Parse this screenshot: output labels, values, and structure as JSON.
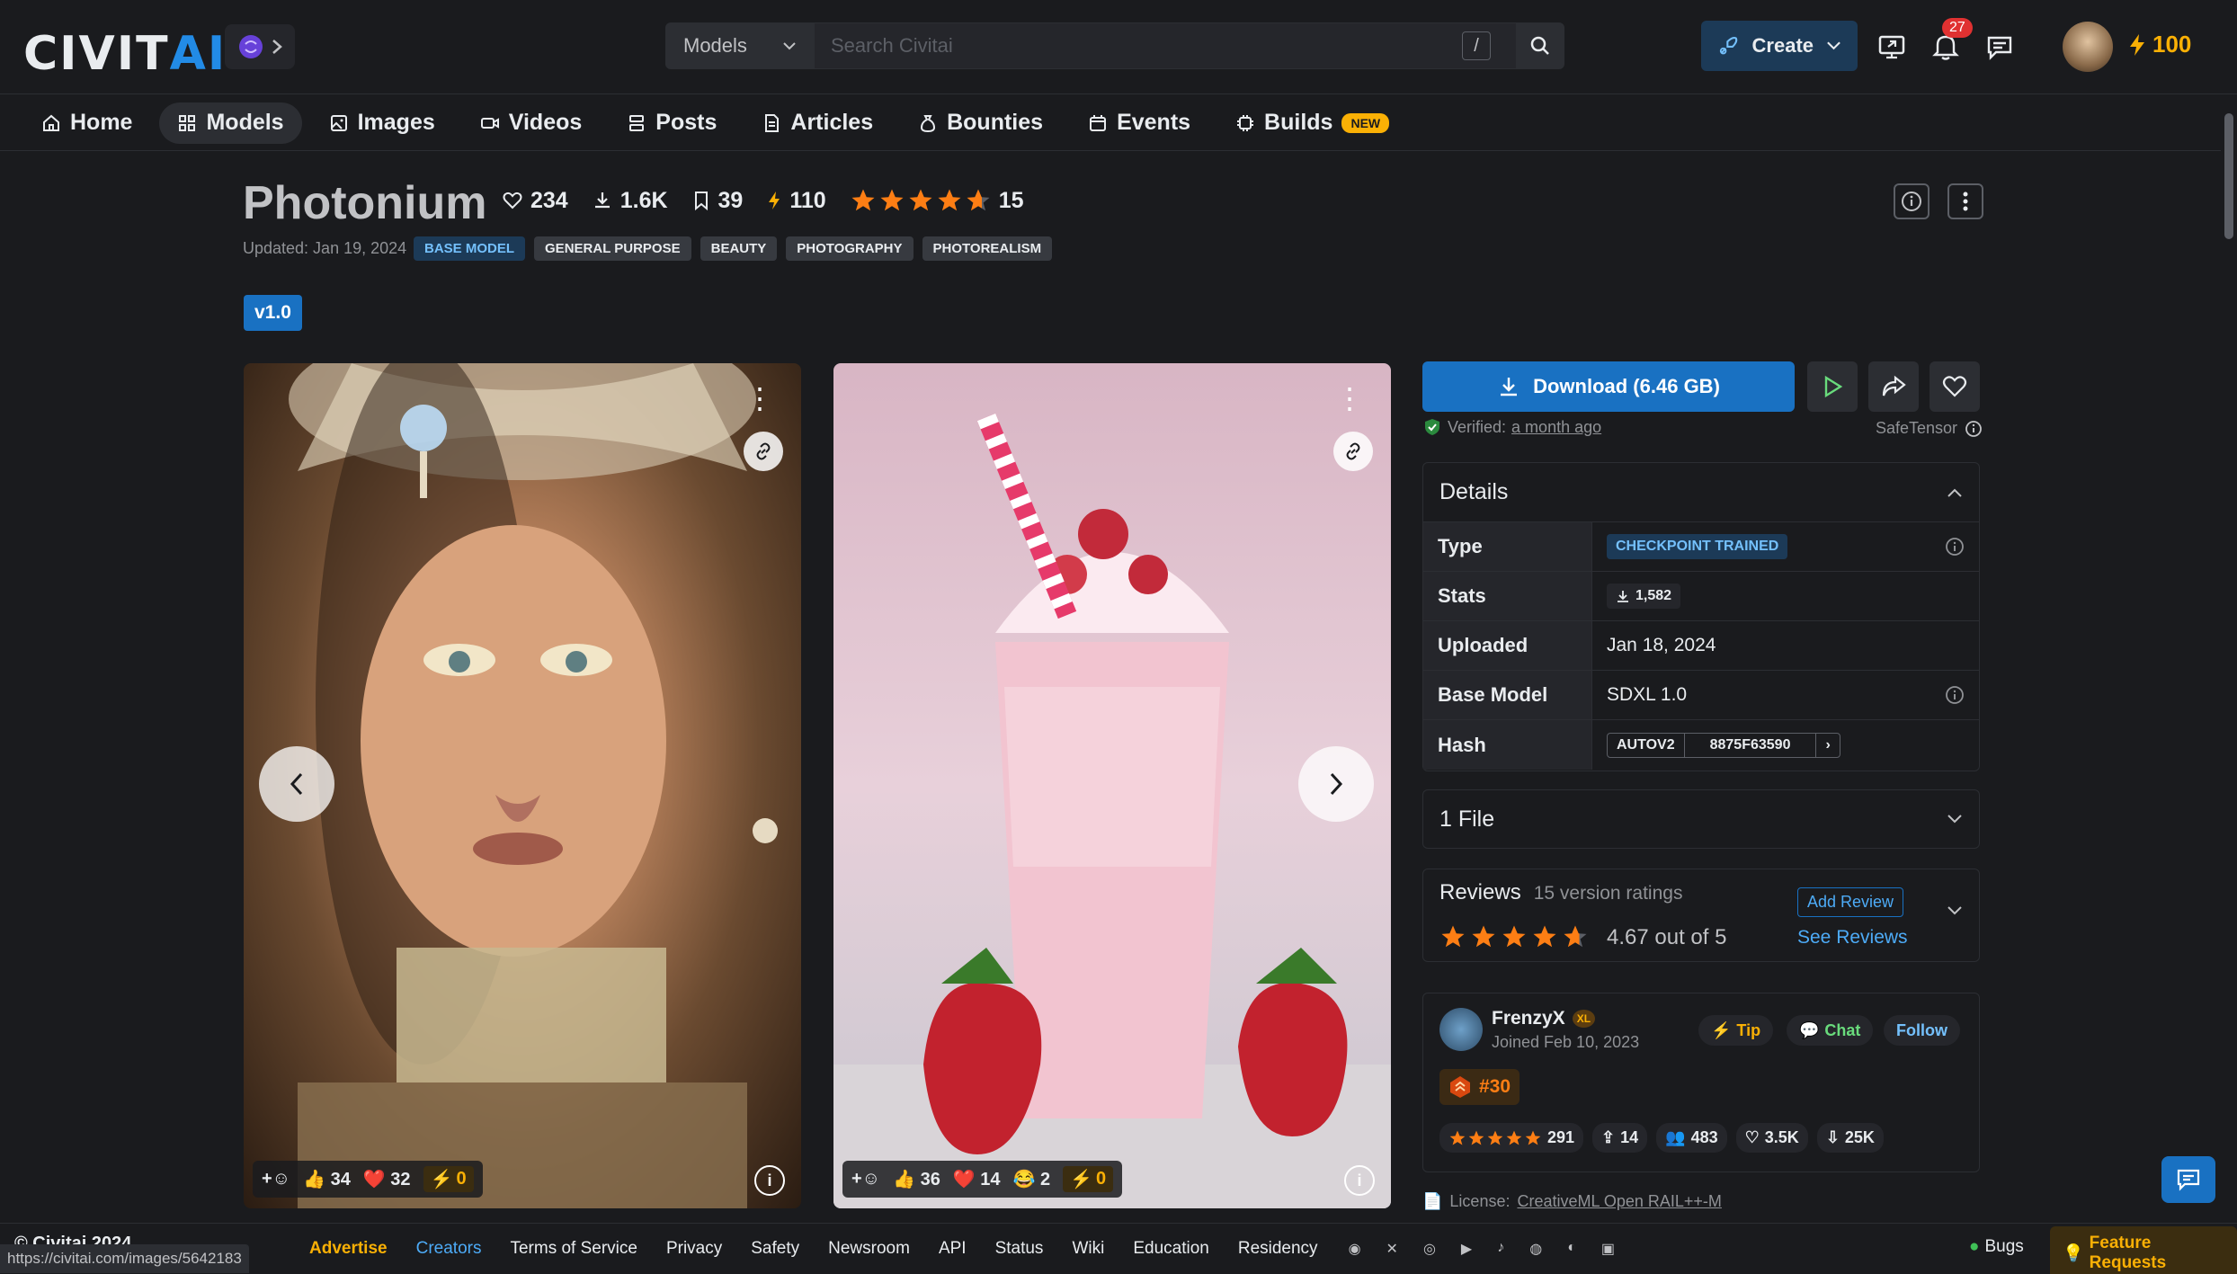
{
  "header": {
    "logo_civit": "CIVIT",
    "logo_ai": "AI",
    "search_category": "Models",
    "search_placeholder": "Search Civitai",
    "search_shortcut": "/",
    "create_label": "Create",
    "notification_count": "27",
    "buzz_amount": "100"
  },
  "nav": {
    "items": [
      {
        "label": "Home",
        "icon": "home-icon"
      },
      {
        "label": "Models",
        "icon": "grid-icon"
      },
      {
        "label": "Images",
        "icon": "photo-icon"
      },
      {
        "label": "Videos",
        "icon": "video-icon"
      },
      {
        "label": "Posts",
        "icon": "posts-icon"
      },
      {
        "label": "Articles",
        "icon": "article-icon"
      },
      {
        "label": "Bounties",
        "icon": "moneybag-icon"
      },
      {
        "label": "Events",
        "icon": "calendar-icon"
      },
      {
        "label": "Builds",
        "icon": "cpu-icon"
      }
    ],
    "new_badge": "NEW"
  },
  "model": {
    "title": "Photonium",
    "likes": "234",
    "downloads": "1.6K",
    "bookmarks": "39",
    "buzz": "110",
    "rating_count": "15",
    "rating_stars": 4.67,
    "updated": "Updated: Jan 19, 2024",
    "tags": [
      "BASE MODEL",
      "GENERAL PURPOSE",
      "BEAUTY",
      "PHOTOGRAPHY",
      "PHOTOREALISM"
    ],
    "version": "v1.0"
  },
  "gallery": [
    {
      "thumbs": "34",
      "hearts": "32",
      "buzz": "0"
    },
    {
      "thumbs": "36",
      "hearts": "14",
      "laugh": "2",
      "buzz": "0"
    }
  ],
  "sidebar": {
    "download_label": "Download (6.46 GB)",
    "verified_label": "Verified:",
    "verified_time": "a month ago",
    "safetensor": "SafeTensor",
    "details": {
      "title": "Details",
      "type_label": "Type",
      "type_value": "CHECKPOINT TRAINED",
      "stats_label": "Stats",
      "stats_value": "1,582",
      "uploaded_label": "Uploaded",
      "uploaded_value": "Jan 18, 2024",
      "base_label": "Base Model",
      "base_value": "SDXL 1.0",
      "hash_label": "Hash",
      "hash_type": "AUTOV2",
      "hash_value": "8875F63590"
    },
    "files_label": "1 File",
    "reviews": {
      "title": "Reviews",
      "count": "15 version ratings",
      "score": "4.67 out of 5",
      "add": "Add Review",
      "see": "See Reviews"
    },
    "creator": {
      "name": "FrenzyX",
      "level": "XL",
      "joined": "Joined Feb 10, 2023",
      "tip": "Tip",
      "chat": "Chat",
      "follow": "Follow",
      "rank": "#30",
      "rating": "291",
      "uploads": "14",
      "followers": "483",
      "likes": "3.5K",
      "downloads": "25K"
    },
    "license_label": "License:",
    "license_value": "CreativeML Open RAIL++-M"
  },
  "footer": {
    "copyright": "© Civitai 2024",
    "links": [
      "Advertise",
      "Creators",
      "Terms of Service",
      "Privacy",
      "Safety",
      "Newsroom",
      "API",
      "Status",
      "Wiki",
      "Education",
      "Residency"
    ],
    "bugs": "Bugs",
    "feature_requests": "Feature Requests",
    "status_url": "https://civitai.com/images/5642183"
  },
  "colors": {
    "accent": "#1971c2",
    "buzz": "#fab005",
    "background": "#1a1b1e"
  }
}
